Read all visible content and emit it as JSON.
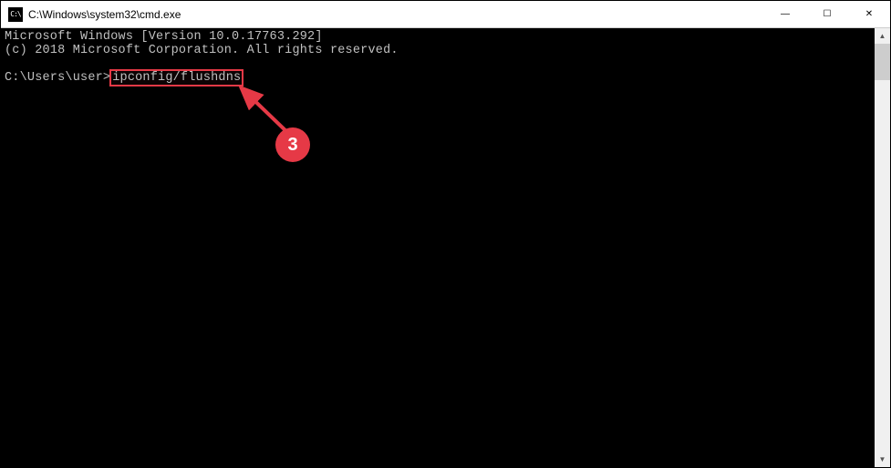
{
  "window": {
    "title": "C:\\Windows\\system32\\cmd.exe",
    "icon_label": "cmd-icon"
  },
  "controls": {
    "minimize": "—",
    "maximize": "☐",
    "close": "✕"
  },
  "console": {
    "line1": "Microsoft Windows [Version 10.0.17763.292]",
    "line2": "(c) 2018 Microsoft Corporation. All rights reserved.",
    "blank": "",
    "prompt": "C:\\Users\\user>",
    "command": "ipconfig/flushdns"
  },
  "annotation": {
    "badge": "3",
    "highlight_color": "#e63946"
  }
}
